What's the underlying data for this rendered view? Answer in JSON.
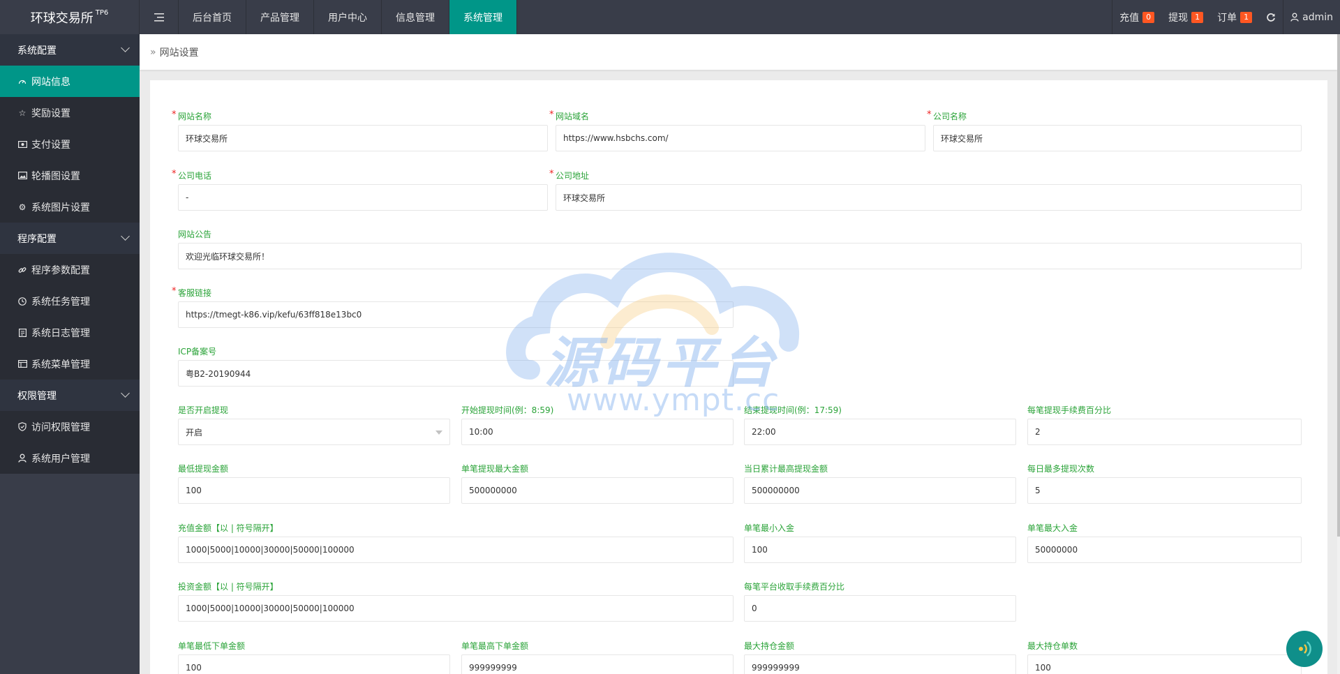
{
  "app": {
    "title": "环球交易所",
    "version": "TP6"
  },
  "topnav": {
    "items": [
      {
        "label": "后台首页"
      },
      {
        "label": "产品管理"
      },
      {
        "label": "用户中心"
      },
      {
        "label": "信息管理"
      },
      {
        "label": "系统管理",
        "active": true
      }
    ]
  },
  "topright": {
    "recharge": {
      "label": "充值",
      "count": "0"
    },
    "withdraw": {
      "label": "提现",
      "count": "1"
    },
    "orders": {
      "label": "订单",
      "count": "1"
    },
    "user": "admin"
  },
  "sidebar": {
    "groups": [
      {
        "label": "系统配置",
        "items": [
          {
            "label": "网站信息",
            "icon": "gauge-icon",
            "active": true
          },
          {
            "label": "奖励设置",
            "icon": "star-icon"
          },
          {
            "label": "支付设置",
            "icon": "money-icon"
          },
          {
            "label": "轮播图设置",
            "icon": "image-icon"
          },
          {
            "label": "系统图片设置",
            "icon": "gear-icon"
          }
        ]
      },
      {
        "label": "程序配置",
        "items": [
          {
            "label": "程序参数配置",
            "icon": "link-icon"
          },
          {
            "label": "系统任务管理",
            "icon": "clock-icon"
          },
          {
            "label": "系统日志管理",
            "icon": "log-icon"
          },
          {
            "label": "系统菜单管理",
            "icon": "menu-icon"
          }
        ]
      },
      {
        "label": "权限管理",
        "items": [
          {
            "label": "访问权限管理",
            "icon": "shield-icon"
          },
          {
            "label": "系统用户管理",
            "icon": "user-icon"
          }
        ]
      }
    ]
  },
  "breadcrumb": "网站设置",
  "form": {
    "site_name": {
      "label": "网站名称",
      "value": "环球交易所"
    },
    "site_domain": {
      "label": "网站域名",
      "value": "https://www.hsbchs.com/"
    },
    "company_name": {
      "label": "公司名称",
      "value": "环球交易所"
    },
    "company_phone": {
      "label": "公司电话",
      "value": "-"
    },
    "company_address": {
      "label": "公司地址",
      "value": "环球交易所"
    },
    "site_notice": {
      "label": "网站公告",
      "value": "欢迎光临环球交易所！"
    },
    "service_link": {
      "label": "客服链接",
      "value": "https://tmegt-k86.vip/kefu/63ff818e13bc0"
    },
    "icp": {
      "label": "ICP备案号",
      "value": "粤B2-20190944"
    },
    "withdraw_enabled": {
      "label": "是否开启提现",
      "value": "开启"
    },
    "withdraw_start": {
      "label": "开始提现时间(例：8:59)",
      "value": "10:00"
    },
    "withdraw_end": {
      "label": "结束提现时间(例：17:59)",
      "value": "22:00"
    },
    "withdraw_fee_pct": {
      "label": "每笔提现手续费百分比",
      "value": "2"
    },
    "withdraw_min": {
      "label": "最低提现金额",
      "value": "100"
    },
    "withdraw_max": {
      "label": "单笔提现最大金额",
      "value": "500000000"
    },
    "withdraw_daily_max": {
      "label": "当日累计最高提现金额",
      "value": "500000000"
    },
    "withdraw_daily_times": {
      "label": "每日最多提现次数",
      "value": "5"
    },
    "recharge_amounts": {
      "label": "充值金额【以 | 符号隔开】",
      "value": "1000|5000|10000|30000|50000|100000"
    },
    "deposit_min": {
      "label": "单笔最小入金",
      "value": "100"
    },
    "deposit_max": {
      "label": "单笔最大入金",
      "value": "50000000"
    },
    "invest_amounts": {
      "label": "投资金额【以 | 符号隔开】",
      "value": "1000|5000|10000|30000|50000|100000"
    },
    "platform_fee_pct": {
      "label": "每笔平台收取手续费百分比",
      "value": "0"
    },
    "order_min": {
      "label": "单笔最低下单金额",
      "value": "100"
    },
    "order_max": {
      "label": "单笔最高下单金额",
      "value": "999999999"
    },
    "hold_max_amount": {
      "label": "最大持仓金额",
      "value": "999999999"
    },
    "hold_max_count": {
      "label": "最大持仓单数",
      "value": "100"
    }
  },
  "watermark": {
    "text": "源码平台",
    "url": "www.ympt.cc"
  },
  "colors": {
    "accent": "#009688",
    "header": "#393d49",
    "label_green": "#2aa338",
    "badge": "#ff5722"
  }
}
